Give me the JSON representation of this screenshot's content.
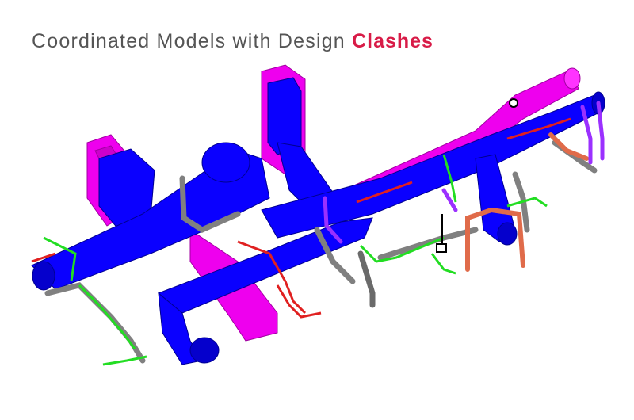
{
  "header": {
    "title_main": "Coordinated Models with Design ",
    "title_accent": "Clashes"
  },
  "colors": {
    "title_text": "#555555",
    "accent": "#d81b47",
    "duct_magenta": "#ee00ee",
    "duct_blue": "#0a00ff",
    "pipe_grey": "#808080",
    "pipe_green": "#22dd22",
    "pipe_red": "#e02020",
    "pipe_orange": "#e06b4a",
    "pipe_purple": "#9b30ff",
    "background": "#ffffff"
  }
}
